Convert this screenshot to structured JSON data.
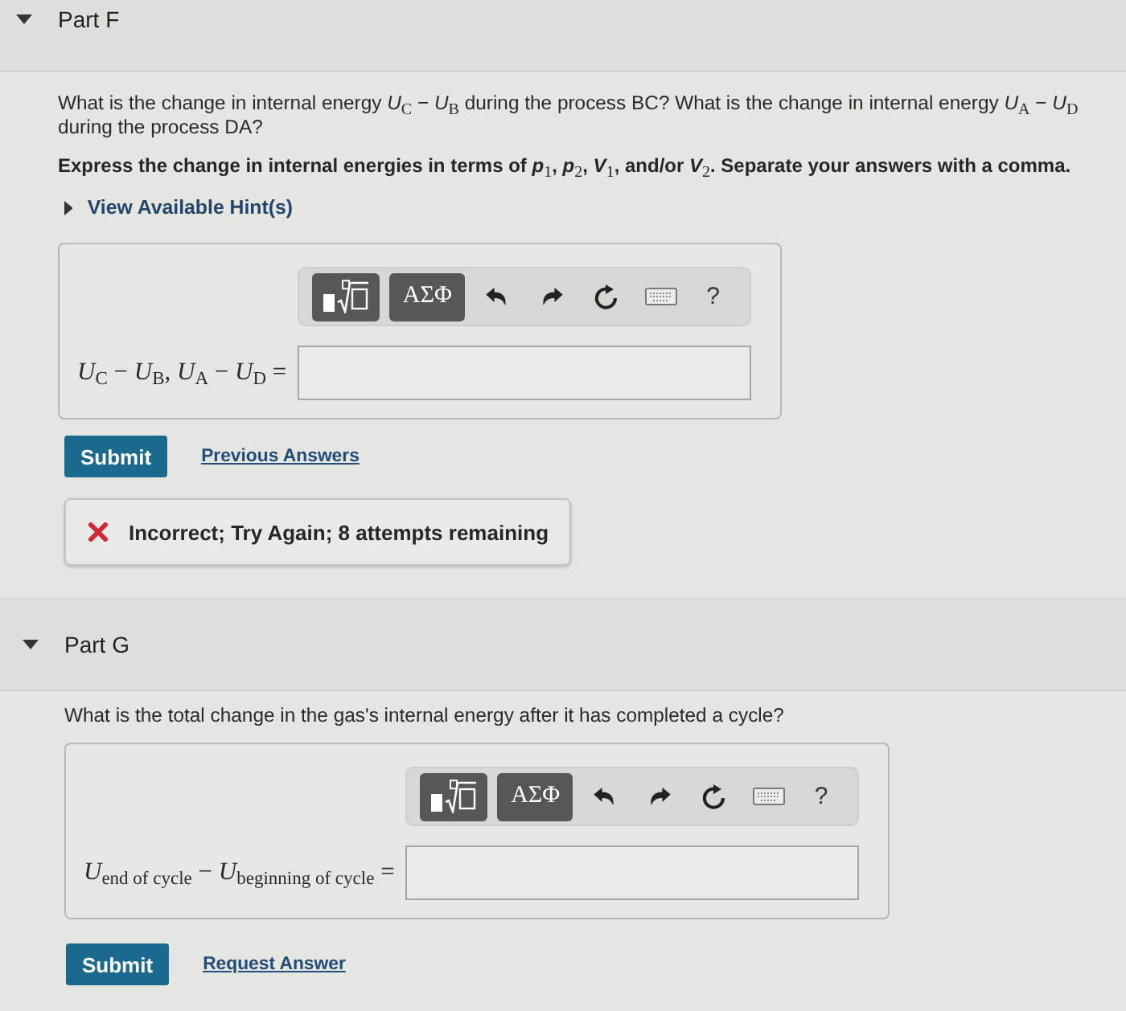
{
  "parts": [
    {
      "title": "Part F",
      "expanded": true,
      "question": "What is the change in internal energy *U*$_{C}$ − *U*$_{B}$ during the process BC? What is the change in internal energy *U*$_{A}$ − *U*$_{D}$ during the process DA?",
      "instruction": "Express the change in internal energies in terms of *p*$_{1}$, *p*$_{2}$, *V*$_{1}$, and/or *V*$_{2}$. Separate your answers with a comma.",
      "hint": {
        "label": "View Available Hint(s)",
        "expanded": false
      },
      "answer": {
        "toolbar": [
          {
            "kind": "template"
          },
          {
            "kind": "symbols",
            "label": "ΑΣΦ"
          },
          {
            "kind": "undo"
          },
          {
            "kind": "redo"
          },
          {
            "kind": "reset"
          },
          {
            "kind": "keyboard"
          },
          {
            "kind": "help",
            "label": "?"
          }
        ],
        "label": "*U*$_{C}$ − *U*$_{B}$, *U*$_{A}$ − *U*$_{D}$ ="
      },
      "submit": "Submit",
      "link": "Previous Answers",
      "feedback": {
        "kind": "incorrect",
        "text": "Incorrect; Try Again; 8 attempts remaining"
      }
    },
    {
      "title": "Part G",
      "expanded": true,
      "question": "What is the total change in the gas's internal energy after it has completed a cycle?",
      "answer": {
        "toolbar": [
          {
            "kind": "template"
          },
          {
            "kind": "symbols",
            "label": "ΑΣΦ"
          },
          {
            "kind": "undo"
          },
          {
            "kind": "redo"
          },
          {
            "kind": "reset"
          },
          {
            "kind": "keyboard"
          },
          {
            "kind": "help",
            "label": "?"
          }
        ],
        "label": "*U*$_{end of cycle}$ − *U*$_{beginning of cycle}$ ="
      },
      "submit": "Submit",
      "link": "Request Answer"
    }
  ]
}
